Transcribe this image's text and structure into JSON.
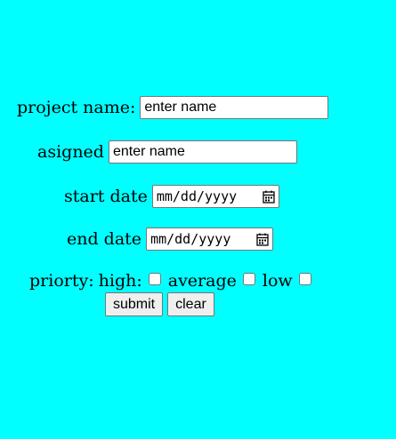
{
  "form": {
    "project_name": {
      "label": "project name:",
      "value": "enter name"
    },
    "assigned": {
      "label": "asigned",
      "value": "enter name"
    },
    "start_date": {
      "label": "start date",
      "placeholder": "mm/dd/yyyy"
    },
    "end_date": {
      "label": "end date",
      "placeholder": "mm/dd/yyyy"
    },
    "priority": {
      "label": "priorty:",
      "options": [
        {
          "label": "high:",
          "checked": false
        },
        {
          "label": "average",
          "checked": false
        },
        {
          "label": "low",
          "checked": false
        }
      ]
    },
    "buttons": {
      "submit": "submit",
      "clear": "clear"
    }
  },
  "colors": {
    "background": "#00ffff"
  },
  "icons": {
    "date_picker": "calendar-icon"
  }
}
